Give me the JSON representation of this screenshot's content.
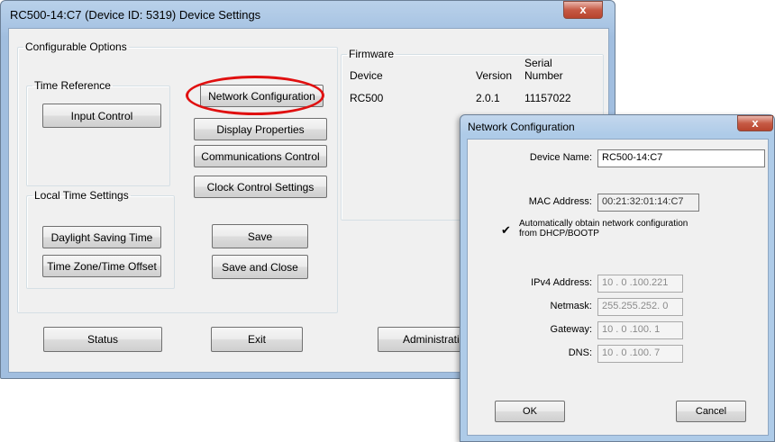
{
  "main_window": {
    "title": "RC500-14:C7 (Device ID: 5319) Device Settings",
    "close_glyph": "x",
    "configurable_options": {
      "legend": "Configurable Options",
      "time_reference": {
        "legend": "Time Reference",
        "input_control": "Input Control"
      },
      "local_time_settings": {
        "legend": "Local Time Settings",
        "daylight_saving_time": "Daylight Saving Time",
        "time_zone_offset": "Time Zone/Time Offset"
      },
      "network_configuration": "Network Configuration",
      "display_properties": "Display Properties",
      "communications_control": "Communications Control",
      "clock_control_settings": "Clock Control Settings",
      "save": "Save",
      "save_and_close": "Save and Close"
    },
    "firmware": {
      "legend": "Firmware",
      "headers": {
        "device": "Device",
        "version": "Version",
        "serial_1": "Serial",
        "serial_2": "Number"
      },
      "row": {
        "device": "RC500",
        "version": "2.0.1",
        "serial": "11157022"
      }
    },
    "footer": {
      "status": "Status",
      "exit": "Exit",
      "administration": "Administration"
    }
  },
  "network_dialog": {
    "title": "Network Configuration",
    "close_glyph": "x",
    "device_name_label": "Device Name:",
    "device_name_value": "RC500-14:C7",
    "mac_label": "MAC Address:",
    "mac_value": "00:21:32:01:14:C7",
    "dhcp_checkbox": {
      "checked": true,
      "mark": "✔",
      "line1": "Automatically obtain network configuration",
      "line2": "from DHCP/BOOTP"
    },
    "ipv4_label": "IPv4 Address:",
    "ipv4_value": "10 .  0 .100.221",
    "netmask_label": "Netmask:",
    "netmask_value": "255.255.252.  0",
    "gateway_label": "Gateway:",
    "gateway_value": "10 .  0 .100.  1",
    "dns_label": "DNS:",
    "dns_value": "10 .  0 .100.  7",
    "ok": "OK",
    "cancel": "Cancel"
  },
  "colors": {
    "highlight_ellipse": "#e01010",
    "title_bar": "#b9d1ea",
    "close_button": "#c65a45"
  }
}
